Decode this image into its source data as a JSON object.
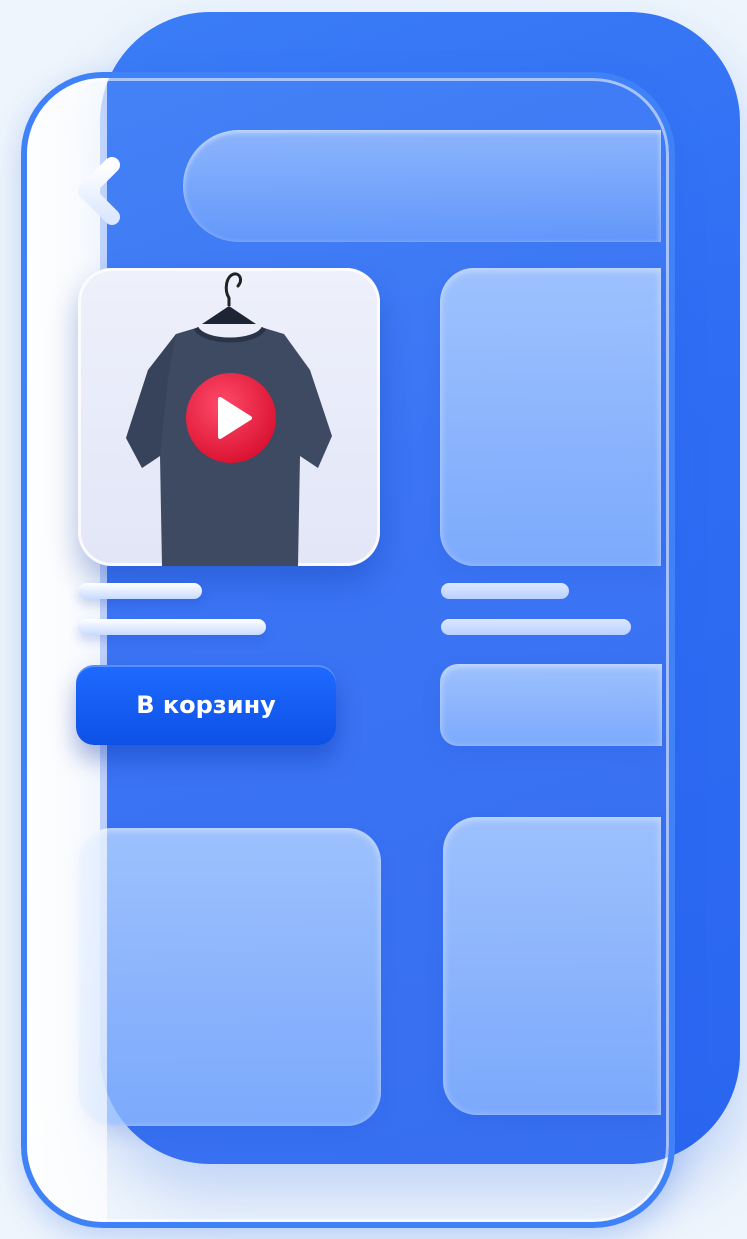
{
  "product": {
    "add_to_cart_label": "В корзину",
    "image_icon": "t-shirt-on-hanger",
    "play_icon": "play-icon"
  },
  "colors": {
    "accent": "#2f6df4",
    "button": "#1262f5",
    "play": "#e8183f",
    "shirt": "#3d4a62"
  }
}
